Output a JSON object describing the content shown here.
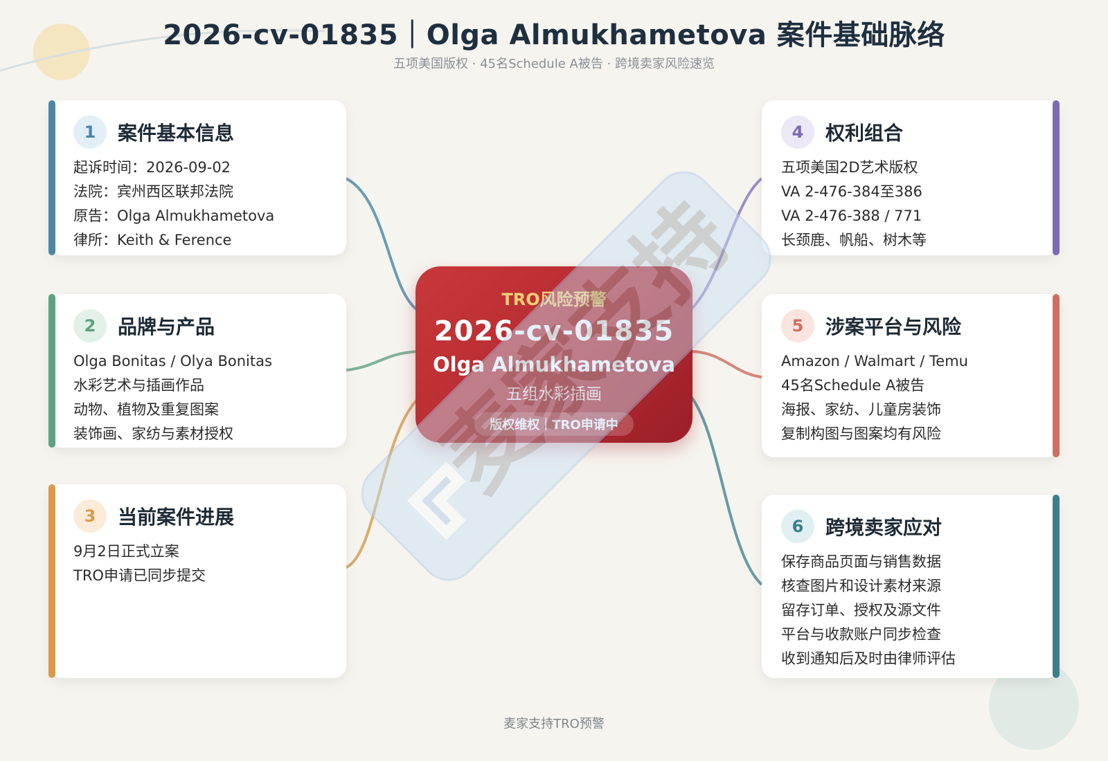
{
  "title": "2026-cv-01835｜Olga Almukhametova 案件基础脉络",
  "subtitle": "五项美国版权 · 45名Schedule A被告 · 跨境卖家风险速览",
  "center": {
    "tag": "TRO风险预警",
    "case_no": "2026-cv-01835",
    "plaintiff": "Olga Almukhametova",
    "desc": "五组水彩插画",
    "badge": "版权维权｜TRO申请中"
  },
  "cards": [
    {
      "num": "1",
      "title": "案件基本信息",
      "accent": "#4b86a8",
      "lines": [
        "起诉时间：2026-09-02",
        "法院：宾州西区联邦法院",
        "原告：Olga Almukhametova",
        "律所：Keith & Ference"
      ]
    },
    {
      "num": "2",
      "title": "品牌与产品",
      "accent": "#5ea17e",
      "lines": [
        "Olga Bonitas / Olya Bonitas",
        "水彩艺术与插画作品",
        "动物、植物及重复图案",
        "装饰画、家纺与素材授权"
      ]
    },
    {
      "num": "3",
      "title": "当前案件进展",
      "accent": "#db9a4a",
      "lines": [
        "9月2日正式立案",
        "TRO申请已同步提交"
      ]
    },
    {
      "num": "4",
      "title": "权利组合",
      "accent": "#7c6bb3",
      "lines": [
        "五项美国2D艺术版权",
        "VA 2-476-384至386",
        "VA 2-476-388 / 771",
        "长颈鹿、帆船、树木等"
      ]
    },
    {
      "num": "5",
      "title": "涉案平台与风险",
      "accent": "#cf6e60",
      "lines": [
        "Amazon / Walmart / Temu",
        "45名Schedule A被告",
        "海报、家纺、儿童房装饰",
        "复制构图与图案均有风险"
      ]
    },
    {
      "num": "6",
      "title": "跨境卖家应对",
      "accent": "#3a7f8c",
      "lines": [
        "保存商品页面与销售数据",
        "核查图片和设计素材来源",
        "留存订单、授权及源文件",
        "平台与收款账户同步检查",
        "收到通知后及时由律师评估"
      ]
    }
  ],
  "watermark": {
    "text": "麦家支持",
    "logo_icon": "maijia-logo-icon"
  },
  "footer": "麦家支持TRO预警"
}
